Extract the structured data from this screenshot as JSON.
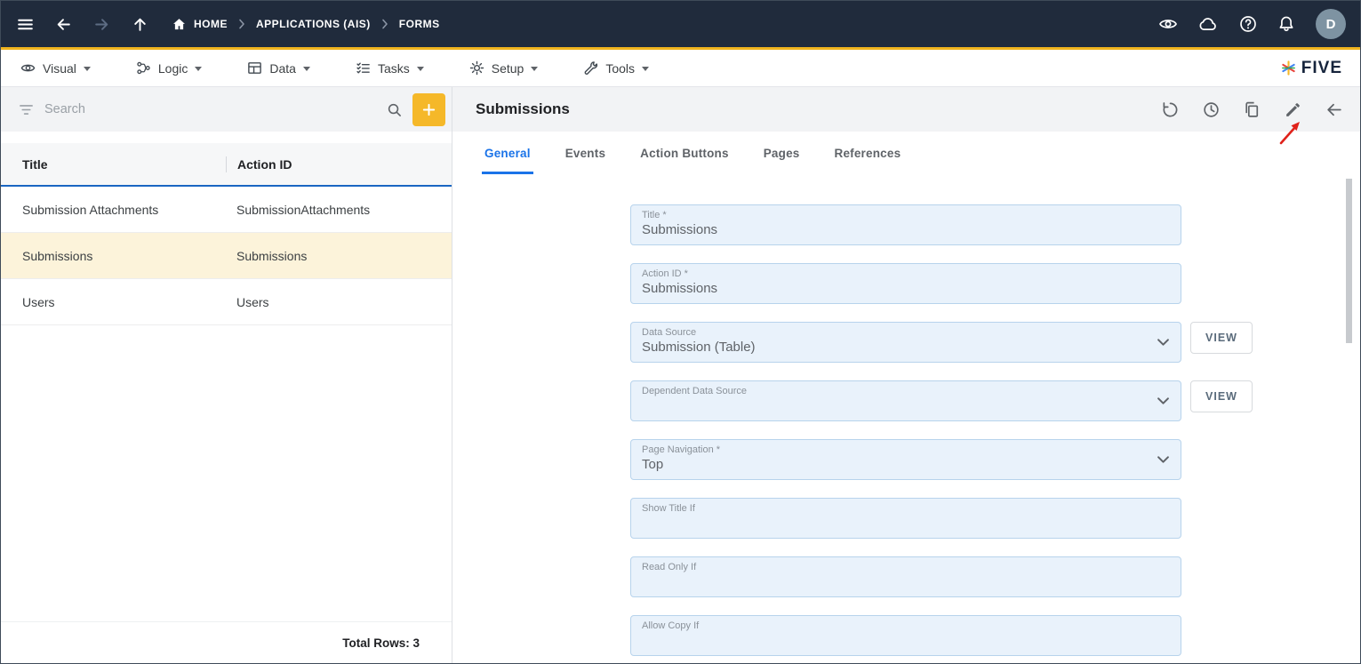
{
  "topbar": {
    "breadcrumb": {
      "home": "HOME",
      "app": "APPLICATIONS (AIS)",
      "page": "FORMS"
    },
    "avatar_letter": "D"
  },
  "menubar": {
    "items": [
      {
        "label": "Visual"
      },
      {
        "label": "Logic"
      },
      {
        "label": "Data"
      },
      {
        "label": "Tasks"
      },
      {
        "label": "Setup"
      },
      {
        "label": "Tools"
      }
    ],
    "brand": "FIVE"
  },
  "left_panel": {
    "search": {
      "placeholder": "Search"
    },
    "table": {
      "columns": [
        "Title",
        "Action ID"
      ],
      "rows": [
        {
          "title": "Submission Attachments",
          "action_id": "SubmissionAttachments"
        },
        {
          "title": "Submissions",
          "action_id": "Submissions"
        },
        {
          "title": "Users",
          "action_id": "Users"
        }
      ],
      "selected_row_index": 1,
      "footer": "Total Rows: 3"
    }
  },
  "detail_panel": {
    "title": "Submissions",
    "tabs": [
      {
        "label": "General",
        "active": true
      },
      {
        "label": "Events",
        "active": false
      },
      {
        "label": "Action Buttons",
        "active": false
      },
      {
        "label": "Pages",
        "active": false
      },
      {
        "label": "References",
        "active": false
      }
    ],
    "view_button_label": "VIEW",
    "fields": [
      {
        "label": "Title *",
        "value": "Submissions",
        "type": "text"
      },
      {
        "label": "Action ID *",
        "value": "Submissions",
        "type": "text"
      },
      {
        "label": "Data Source",
        "value": "Submission (Table)",
        "type": "select",
        "has_view": true
      },
      {
        "label": "Dependent Data Source",
        "value": "",
        "type": "select",
        "has_view": true
      },
      {
        "label": "Page Navigation *",
        "value": "Top",
        "type": "select"
      },
      {
        "label": "Show Title If",
        "value": "",
        "type": "text"
      },
      {
        "label": "Read Only If",
        "value": "",
        "type": "text"
      },
      {
        "label": "Allow Copy If",
        "value": "",
        "type": "text"
      }
    ]
  },
  "colors": {
    "topbar_bg": "#202B3C",
    "accent_gold": "#F0B41E",
    "accent_blue": "#1A73E8",
    "table_header_underline": "#1A66C2",
    "selected_row_bg": "#FCF3DA",
    "field_bg": "#E9F2FB",
    "field_border": "#B7D3EC",
    "annotation_red": "#E0211A"
  }
}
